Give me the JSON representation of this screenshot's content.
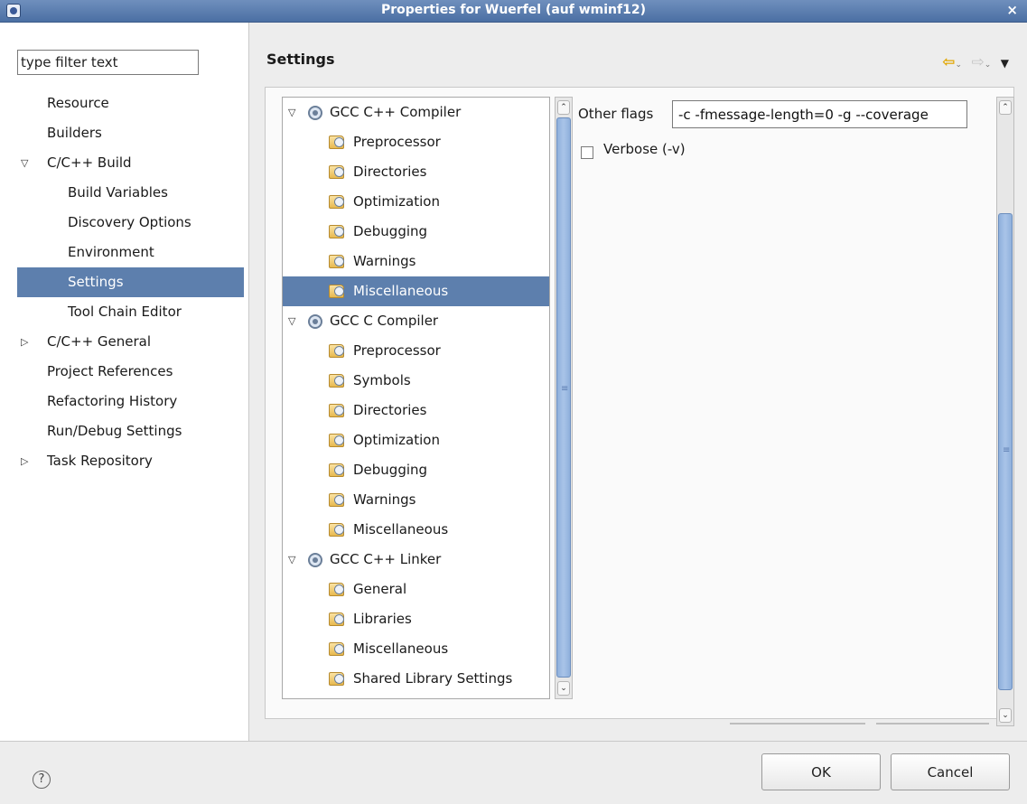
{
  "window": {
    "title": "Properties for Wuerfel  (auf wminf12)",
    "close_glyph": "×"
  },
  "filter": {
    "placeholder": "type filter text",
    "value": "type filter text"
  },
  "nav": [
    {
      "label": "Resource",
      "level": 0
    },
    {
      "label": "Builders",
      "level": 0
    },
    {
      "label": "C/C++ Build",
      "level": 0,
      "expander": "▽"
    },
    {
      "label": "Build Variables",
      "level": 1
    },
    {
      "label": "Discovery Options",
      "level": 1
    },
    {
      "label": "Environment",
      "level": 1
    },
    {
      "label": "Settings",
      "level": 1,
      "selected": true
    },
    {
      "label": "Tool Chain Editor",
      "level": 1
    },
    {
      "label": "C/C++ General",
      "level": 0,
      "expander": "▷"
    },
    {
      "label": "Project References",
      "level": 0
    },
    {
      "label": "Refactoring History",
      "level": 0
    },
    {
      "label": "Run/Debug Settings",
      "level": 0
    },
    {
      "label": "Task Repository",
      "level": 0,
      "expander": "▷"
    }
  ],
  "header": {
    "title": "Settings",
    "back_icon": "⇦",
    "forward_icon": "⇨",
    "dropdown_icon": "⌄",
    "menu_icon": "▼"
  },
  "tools": [
    {
      "label": "GCC C++ Compiler",
      "type": "tool",
      "expander": "▽"
    },
    {
      "label": "Preprocessor",
      "type": "option"
    },
    {
      "label": "Directories",
      "type": "option"
    },
    {
      "label": "Optimization",
      "type": "option"
    },
    {
      "label": "Debugging",
      "type": "option"
    },
    {
      "label": "Warnings",
      "type": "option"
    },
    {
      "label": "Miscellaneous",
      "type": "option",
      "selected": true
    },
    {
      "label": "GCC C Compiler",
      "type": "tool",
      "expander": "▽"
    },
    {
      "label": "Preprocessor",
      "type": "option"
    },
    {
      "label": "Symbols",
      "type": "option"
    },
    {
      "label": "Directories",
      "type": "option"
    },
    {
      "label": "Optimization",
      "type": "option"
    },
    {
      "label": "Debugging",
      "type": "option"
    },
    {
      "label": "Warnings",
      "type": "option"
    },
    {
      "label": "Miscellaneous",
      "type": "option"
    },
    {
      "label": "GCC C++ Linker",
      "type": "tool",
      "expander": "▽"
    },
    {
      "label": "General",
      "type": "option"
    },
    {
      "label": "Libraries",
      "type": "option"
    },
    {
      "label": "Miscellaneous",
      "type": "option"
    },
    {
      "label": "Shared Library Settings",
      "type": "option"
    }
  ],
  "settings": {
    "other_flags_label": "Other flags",
    "other_flags_value": "-c -fmessage-length=0 -g --coverage",
    "verbose_label": "Verbose (-v)",
    "verbose_checked": false
  },
  "footer": {
    "help_glyph": "?",
    "ok_label": "OK",
    "cancel_label": "Cancel"
  },
  "scroll_glyphs": {
    "up": "⌃",
    "down": "⌄",
    "grip": "≡"
  },
  "colors": {
    "selection": "#5d7fad",
    "titlebar": "#5a7cb0",
    "scrollbar_thumb": "#9bb9e2"
  }
}
